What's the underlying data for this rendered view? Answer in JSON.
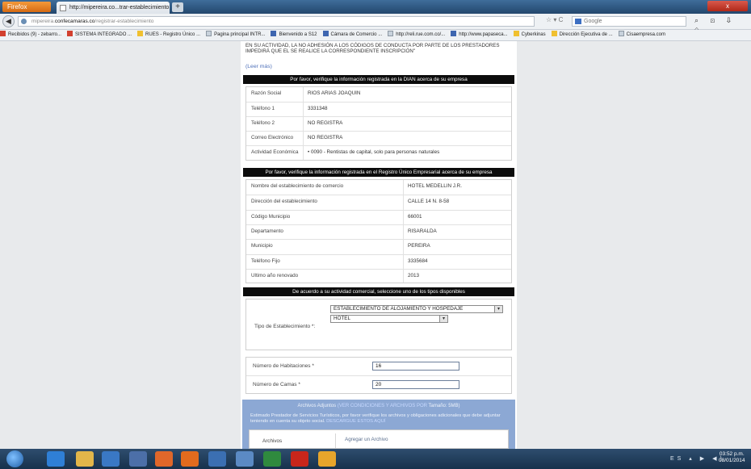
{
  "browser": {
    "app_button": "Firefox",
    "tab_title": "http://mipereira.co...trar-establecimiento",
    "new_tab": "+",
    "close": "x",
    "url_prefix": "mipereira.",
    "url_domain": "confecamaras.co",
    "url_path": "/registrar-establecimiento",
    "search_placeholder": "Google",
    "nav_icons": "⌕ ⊡ ⇩ ⌂"
  },
  "bookmarks": [
    {
      "label": "Recibidos (9) - zebarro...",
      "icon": "rd"
    },
    {
      "label": "SISTEMA INTEGRADO ...",
      "icon": "rd"
    },
    {
      "label": "RUES - Registro Único ...",
      "icon": "yl"
    },
    {
      "label": "Pagina principal INTR...",
      "icon": ""
    },
    {
      "label": "Bienvenido a S12",
      "icon": "fx"
    },
    {
      "label": "Cámara de Comercio ...",
      "icon": "fx"
    },
    {
      "label": "http://reli.rue.com.co/...",
      "icon": ""
    },
    {
      "label": "http://www.papaseca...",
      "icon": "fx"
    },
    {
      "label": "Cyberkinas",
      "icon": "yl"
    },
    {
      "label": "Dirección Ejecutiva de ...",
      "icon": "yl"
    },
    {
      "label": "Cisaempresa.com",
      "icon": ""
    }
  ],
  "page": {
    "warning": "en su actividad, la no adhesión a los códigos de conducta por parte de los prestadores impedirá que el se realice la correspondiente inscripción\"",
    "read_more": "(Leer más)",
    "dian": {
      "header": "Por favor, verifique la información registrada en la DIAN acerca de su empresa",
      "rows": [
        {
          "label": "Razón Social",
          "value": "RIOS ARIAS JOAQUIN"
        },
        {
          "label": "Teléfono 1",
          "value": "3331348"
        },
        {
          "label": "Teléfono 2",
          "value": "NO REGISTRA"
        },
        {
          "label": "Correo Electrónico",
          "value": "NO REGISTRA"
        },
        {
          "label": "Actividad Económica",
          "value": "• 0090 - Rentistas de capital, solo para personas naturales"
        }
      ]
    },
    "rue": {
      "header": "Por favor, verifique la información registrada en el Registro Único Empresarial acerca de su empresa",
      "rows": [
        {
          "label": "Nombre del establecimiento de comercio",
          "value": "HOTEL MEDELLIN J.R."
        },
        {
          "label": "Dirección del establecimiento",
          "value": "CALLE 14 N. 8-58"
        },
        {
          "label": "Código Municipio",
          "value": "66001"
        },
        {
          "label": "Departamento",
          "value": "RISARALDA"
        },
        {
          "label": "Municipio",
          "value": "PEREIRA"
        },
        {
          "label": "Teléfono Fijo",
          "value": "3335684"
        },
        {
          "label": "Ultimo año renovado",
          "value": "2013"
        }
      ]
    },
    "activity": {
      "header": "De acuerdo a su actividad comercial, seleccione uno de los tipos disponibles",
      "type_label": "Tipo de Establecimiento *:",
      "type_value": "ESTABLECIMIENTO DE ALOJAMIENTO Y HOSPEDAJE",
      "subtype_value": "HOTEL"
    },
    "rooms_label": "Número de Habitaciones *",
    "rooms_value": "16",
    "beds_label": "Número de Camas *",
    "beds_value": "20",
    "attachments": {
      "title_prefix": "Archivos Adjuntos",
      "title_link": "(VER CONDICIONES Y ARCHIVOS POR",
      "title_suffix": "Tamaño: 5MB)",
      "description": "Estimado Prestador de Servicios Turísticos, por favor verifique los archivos y obligaciones adicionales que debe adjuntar teniendo en cuenta su objeto social.",
      "description_link": "DESCARGUE ESTOS AQUÍ",
      "files_label": "Archivos",
      "add_file": "Agregar un Archivo"
    }
  },
  "taskbar": {
    "tray": "ES ▴ ▶ ◀)",
    "time": "03:52 p.m.",
    "date": "08/01/2014"
  }
}
